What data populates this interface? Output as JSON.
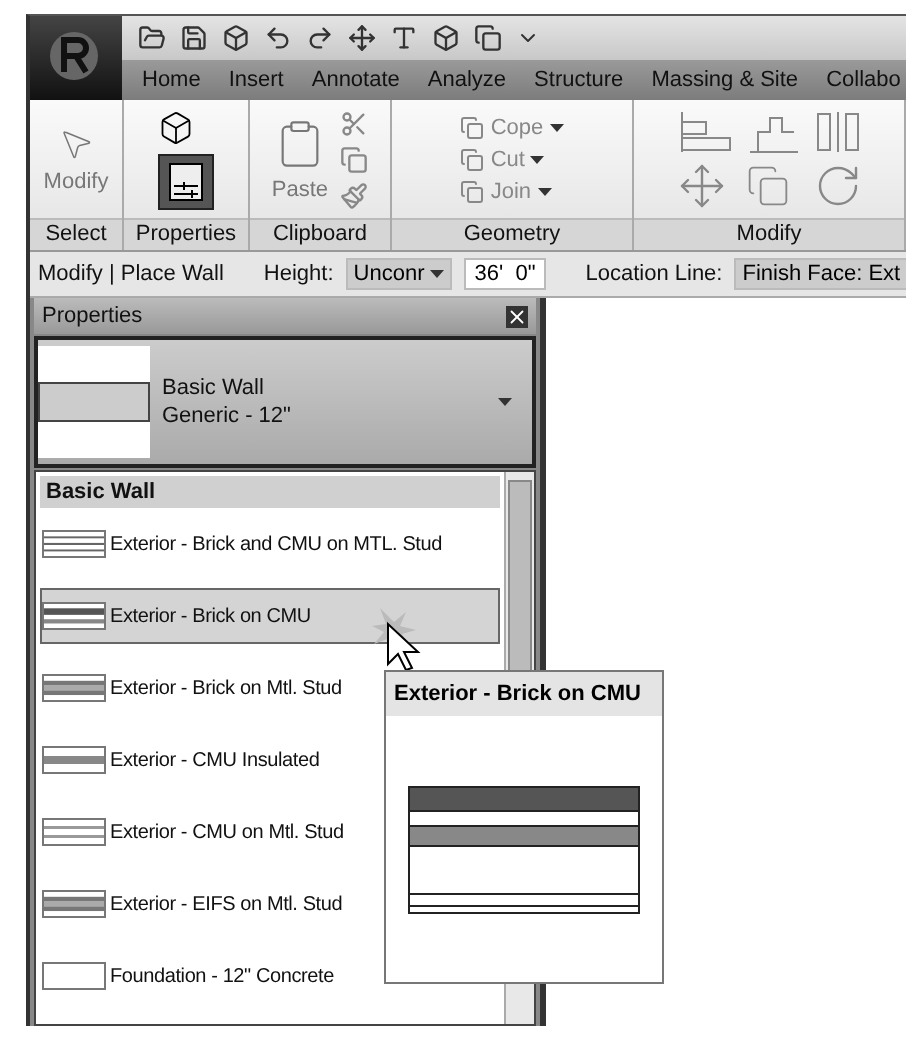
{
  "ribbon_tabs": [
    {
      "label": "Home"
    },
    {
      "label": "Insert"
    },
    {
      "label": "Annotate"
    },
    {
      "label": "Analyze"
    },
    {
      "label": "Structure"
    },
    {
      "label": "Massing & Site"
    },
    {
      "label": "Collabo"
    }
  ],
  "ribbon_panels": [
    {
      "label": "Select",
      "kind": "select",
      "tools": [
        {
          "label": "Modify"
        }
      ]
    },
    {
      "label": "Properties",
      "kind": "properties"
    },
    {
      "label": "Clipboard",
      "kind": "clipboard",
      "tools": [
        {
          "label": "Paste"
        }
      ]
    },
    {
      "label": "Geometry",
      "kind": "geometry",
      "tools": [
        {
          "label": "Cope"
        },
        {
          "label": "Cut"
        },
        {
          "label": "Join"
        }
      ]
    },
    {
      "label": "Modify",
      "kind": "modify"
    }
  ],
  "options_bar": {
    "mode": "Modify | Place Wall",
    "height_label": "Height:",
    "height_value": "Unconr",
    "height_offset": "36'  0\"",
    "location_label": "Location Line:",
    "location_value": "Finish Face: Ext"
  },
  "properties": {
    "title": "Properties",
    "type_family": "Basic Wall",
    "type_name": "Generic - 12\"",
    "group": "Basic Wall",
    "items": [
      {
        "label": "Exterior - Brick and CMU on MTL. Stud",
        "kind": "triple",
        "selected": false
      },
      {
        "label": "Exterior - Brick on CMU",
        "kind": "dark",
        "selected": true
      },
      {
        "label": "Exterior - Brick on Mtl. Stud",
        "kind": "banded",
        "selected": false
      },
      {
        "label": "Exterior - CMU Insulated",
        "kind": "middle",
        "selected": false
      },
      {
        "label": "Exterior - CMU on Mtl. Stud",
        "kind": "lines",
        "selected": false
      },
      {
        "label": "Exterior - EIFS on Mtl. Stud",
        "kind": "banded",
        "selected": false
      },
      {
        "label": "Foundation - 12\" Concrete",
        "kind": "plain",
        "selected": false
      }
    ]
  },
  "tooltip": {
    "title": "Exterior - Brick on CMU"
  }
}
